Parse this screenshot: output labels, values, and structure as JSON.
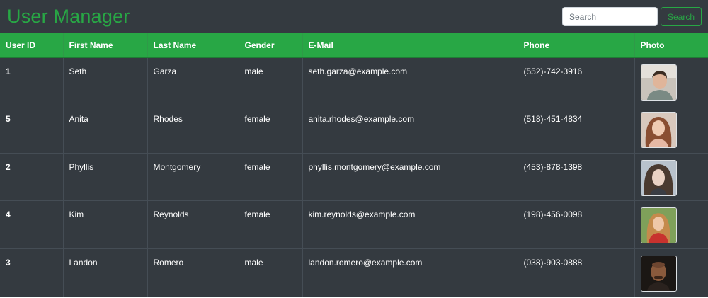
{
  "header": {
    "title": "User Manager",
    "search_placeholder": "Search",
    "search_button_label": "Search"
  },
  "table": {
    "columns": [
      "User ID",
      "First Name",
      "Last Name",
      "Gender",
      "E-Mail",
      "Phone",
      "Photo"
    ],
    "rows": [
      {
        "id": "1",
        "first": "Seth",
        "last": "Garza",
        "gender": "male",
        "email": "seth.garza@example.com",
        "phone": "(552)-742-3916",
        "photo": "man-portrait-light"
      },
      {
        "id": "5",
        "first": "Anita",
        "last": "Rhodes",
        "gender": "female",
        "email": "anita.rhodes@example.com",
        "phone": "(518)-451-4834",
        "photo": "woman-portrait-auburn"
      },
      {
        "id": "2",
        "first": "Phyllis",
        "last": "Montgomery",
        "gender": "female",
        "email": "phyllis.montgomery@example.com",
        "phone": "(453)-878-1398",
        "photo": "woman-portrait-dark"
      },
      {
        "id": "4",
        "first": "Kim",
        "last": "Reynolds",
        "gender": "female",
        "email": "kim.reynolds@example.com",
        "phone": "(198)-456-0098",
        "photo": "woman-portrait-red"
      },
      {
        "id": "3",
        "first": "Landon",
        "last": "Romero",
        "gender": "male",
        "email": "landon.romero@example.com",
        "phone": "(038)-903-0888",
        "photo": "man-portrait-dark"
      }
    ]
  },
  "colors": {
    "accent": "#28a745",
    "table_bg": "#343a40",
    "border": "#454d55"
  }
}
